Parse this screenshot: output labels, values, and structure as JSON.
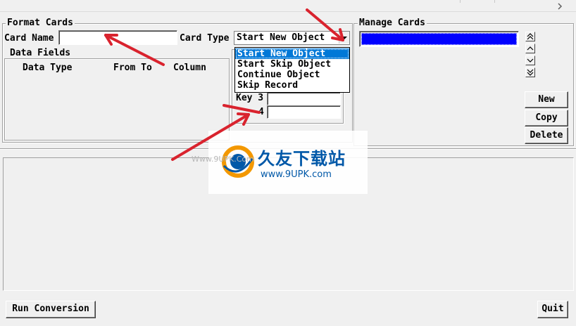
{
  "colors": {
    "list_highlight": "#0000ff",
    "menu_selected": "#0078d7",
    "annotation_arrow": "#d9232e",
    "brand_orange": "#f39800",
    "brand_blue": "#0058a8"
  },
  "format_cards": {
    "title": "Format Cards",
    "card_name_label": "Card Name",
    "card_name_value": "",
    "card_type_label": "Card Type",
    "card_type_value": "Start New Object",
    "card_type_options": [
      "Start New Object",
      "Start Skip Object",
      "Continue Object",
      "Skip Record"
    ],
    "card_type_selected_index": 0,
    "data_fields": {
      "title": "Data Fields",
      "columns": [
        "Data Type",
        "From To",
        "Column"
      ]
    },
    "key3_label": "Key 3",
    "key4_label_visible": "4",
    "key3_value": "",
    "key4_value": ""
  },
  "manage_cards": {
    "title": "Manage Cards",
    "title_first_letter": "M",
    "buttons": {
      "new": "New",
      "copy": "Copy",
      "delete": "Delete"
    },
    "scroll_icons": [
      "double-up-icon",
      "up-icon",
      "down-icon",
      "double-down-icon"
    ]
  },
  "watermark": {
    "brand_cn": "久友下载站",
    "url_small": "www.9UPK.com",
    "url_large": "Www.9UPK.Com"
  },
  "footer": {
    "run_conversion": "Run Conversion",
    "quit": "Quit"
  }
}
